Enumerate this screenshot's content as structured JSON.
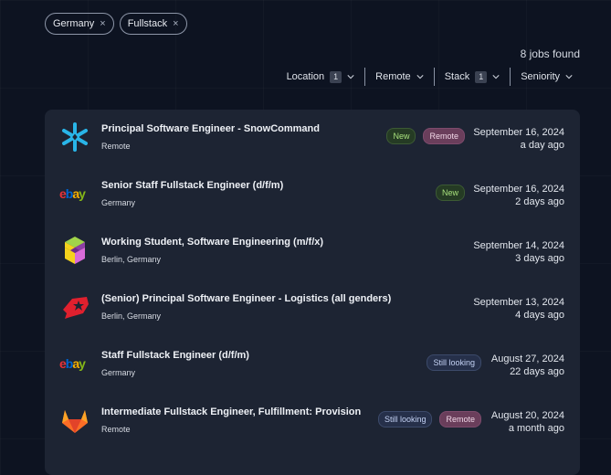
{
  "chips": [
    {
      "label": "Germany",
      "remove": "×"
    },
    {
      "label": "Fullstack",
      "remove": "×"
    }
  ],
  "results_count": "8 jobs found",
  "filters": [
    {
      "label": "Location",
      "badge": "1"
    },
    {
      "label": "Remote",
      "badge": ""
    },
    {
      "label": "Stack",
      "badge": "1"
    },
    {
      "label": "Seniority",
      "badge": ""
    }
  ],
  "jobs": [
    {
      "title": "Principal Software Engineer - SnowCommand",
      "location": "Remote",
      "date": "September 16, 2024",
      "ago": "a day ago",
      "tags": [
        "New",
        "Remote"
      ],
      "logo": "snowflake-logo"
    },
    {
      "title": "Senior Staff Fullstack Engineer (d/f/m)",
      "location": "Germany",
      "date": "September 16, 2024",
      "ago": "2 days ago",
      "tags": [
        "New"
      ],
      "logo": "ebay-logo"
    },
    {
      "title": "Working Student, Software Engineering (m/f/x)",
      "location": "Berlin, Germany",
      "date": "September 14, 2024",
      "ago": "3 days ago",
      "tags": [],
      "logo": "cube-logo"
    },
    {
      "title": "(Senior) Principal Software Engineer - Logistics (all genders)",
      "location": "Berlin, Germany",
      "date": "September 13, 2024",
      "ago": "4 days ago",
      "tags": [],
      "logo": "delivery-hero-logo"
    },
    {
      "title": "Staff Fullstack Engineer (d/f/m)",
      "location": "Germany",
      "date": "August 27, 2024",
      "ago": "22 days ago",
      "tags": [
        "Still looking"
      ],
      "logo": "ebay-logo"
    },
    {
      "title": "Intermediate Fullstack Engineer, Fulfillment: Provision",
      "location": "Remote",
      "date": "August 20, 2024",
      "ago": "a month ago",
      "tags": [
        "Still looking",
        "Remote"
      ],
      "logo": "gitlab-logo"
    }
  ],
  "logo_text": {
    "ebay": "ebay"
  },
  "colors": {
    "background": "#0d1321",
    "panel": "#1d2433",
    "new_tag": "#a7e07c",
    "remote_tag": "#6a3e5b",
    "still_tag": "#26304a"
  }
}
